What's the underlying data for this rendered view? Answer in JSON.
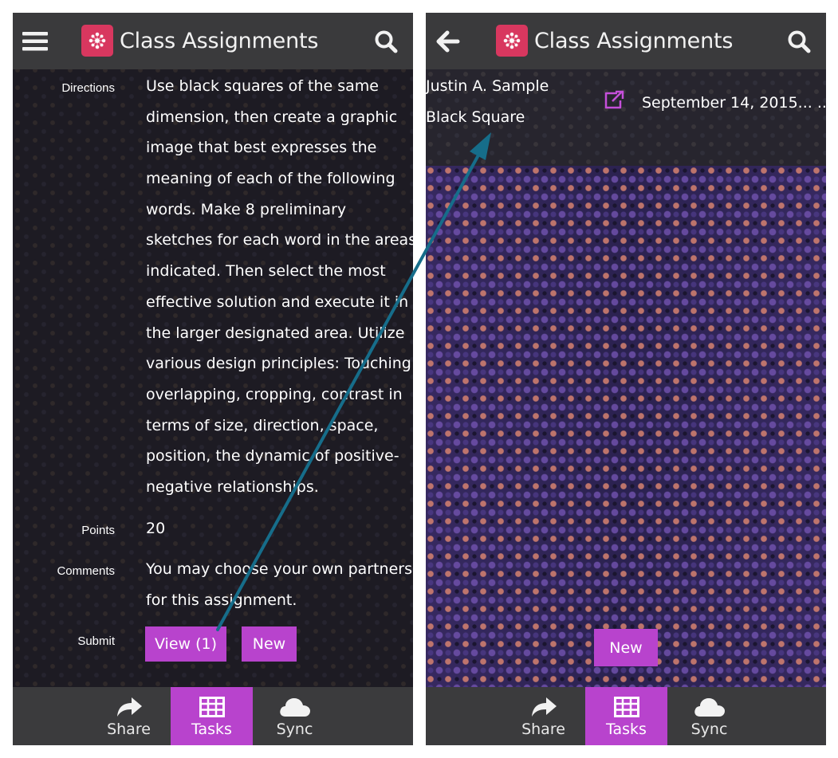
{
  "app": {
    "title": "Class Assignments"
  },
  "left": {
    "rows": {
      "directions_label": "Directions",
      "directions_lines": [
        "Use black squares of the same",
        "dimension, then create a graphic",
        "image that best expresses the",
        "meaning of each of the following",
        "words. Make 8 preliminary",
        "sketches for each word in the areas",
        "indicated. Then select the most",
        "effective solution and execute it in",
        "the larger designated area. Utilize",
        "various design principles: Touching",
        "overlapping, cropping, contrast in",
        "terms of size, direction, space,",
        "position, the dynamic of positive-",
        "negative relationships."
      ],
      "points_label": "Points",
      "points_value": "20",
      "comments_label": "Comments",
      "comments_lines": [
        "You may choose your own partners",
        "for this assignment."
      ],
      "submit_label": "Submit",
      "view_button": "View (1)",
      "new_button": "New"
    }
  },
  "right": {
    "submission": {
      "student": "Justin A. Sample",
      "title": "Black Square",
      "date": "September 14, 2015... ..."
    },
    "new_button": "New"
  },
  "tabs": [
    {
      "label": "Share",
      "icon": "share-icon"
    },
    {
      "label": "Tasks",
      "icon": "grid-icon"
    },
    {
      "label": "Sync",
      "icon": "cloud-icon"
    }
  ],
  "colors": {
    "header_bg": "#3a3a3c",
    "accent": "#b843cd",
    "logo": "#d8375f",
    "arrow": "#166d8a",
    "external_link": "#c54fd9"
  }
}
